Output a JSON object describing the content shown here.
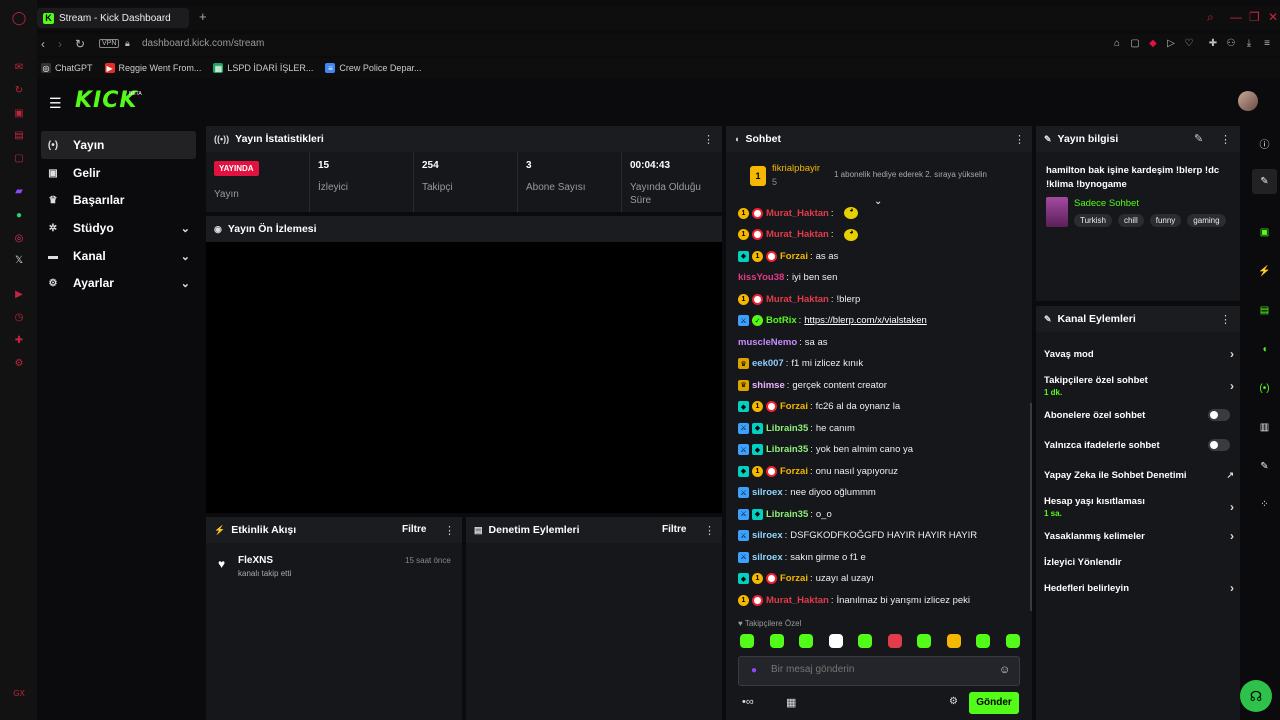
{
  "browser": {
    "tab_title": "Stream - Kick Dashboard",
    "url_host": "dashboard.kick.com",
    "url_path": "/stream",
    "vpn": "VPN",
    "bookmarks": [
      "ChatGPT",
      "Reggie Went From...",
      "LSPD İDARİ İŞLER...",
      "Crew Police Depar..."
    ]
  },
  "app": {
    "logo": "KICK",
    "beta": "BETA"
  },
  "nav": [
    {
      "label": "Yayın",
      "icon": "broadcast-icon",
      "glyph": "((•))",
      "active": true
    },
    {
      "label": "Gelir",
      "icon": "wallet-icon",
      "glyph": "▣"
    },
    {
      "label": "Başarılar",
      "icon": "trophy-icon",
      "glyph": "🏆"
    },
    {
      "label": "Stüdyo",
      "icon": "studio-icon",
      "glyph": "✱",
      "expandable": true
    },
    {
      "label": "Kanal",
      "icon": "channel-icon",
      "glyph": "▬",
      "expandable": true
    },
    {
      "label": "Ayarlar",
      "icon": "settings-icon",
      "glyph": "⚙",
      "expandable": true
    }
  ],
  "stats": {
    "title": "Yayın İstatistikleri",
    "status_badge": "YAYINDA",
    "status_label": "Yayın",
    "items": [
      {
        "value": "15",
        "label": "İzleyici"
      },
      {
        "value": "254",
        "label": "Takipçi"
      },
      {
        "value": "3",
        "label": "Abone Sayısı"
      },
      {
        "value": "00:04:43",
        "label": "Yayında Olduğu Süre"
      }
    ]
  },
  "preview": {
    "title": "Yayın Ön İzlemesi"
  },
  "activity": {
    "title": "Etkinlik Akışı",
    "filter": "Filtre",
    "events": [
      {
        "user": "FleXNS",
        "action": "kanalı takip etti",
        "time": "15 saat önce"
      }
    ]
  },
  "moderation": {
    "title": "Denetim Eylemleri",
    "filter": "Filtre"
  },
  "chat": {
    "title": "Sohbet",
    "pinned": {
      "user": "fikrialpbayir",
      "count": "5",
      "text": "1 abonelik hediye ederek 2. sıraya yükselin"
    },
    "messages": [
      {
        "badges": [
          "sub",
          "pb"
        ],
        "user": "Murat_Haktan",
        "color": "#e23b4a",
        "text": "",
        "emote": true
      },
      {
        "badges": [
          "sub",
          "pb"
        ],
        "user": "Murat_Haktan",
        "color": "#e23b4a",
        "text": "",
        "emote": true
      },
      {
        "badges": [
          "og",
          "sub",
          "pb"
        ],
        "user": "Forzai",
        "color": "#f5b700",
        "text": "as as"
      },
      {
        "badges": [],
        "user": "kissYou38",
        "color": "#e23b8a",
        "text": "iyi ben sen"
      },
      {
        "badges": [
          "sub",
          "pb"
        ],
        "user": "Murat_Haktan",
        "color": "#e23b4a",
        "text": "!blerp"
      },
      {
        "badges": [
          "mod",
          "bot"
        ],
        "user": "BotRix",
        "color": "#53fc18",
        "text": "https://blerp.com/x/vialstaken",
        "link": true
      },
      {
        "badges": [],
        "user": "muscleNemo",
        "color": "#c48dff",
        "text": "sa as"
      },
      {
        "badges": [
          "vip"
        ],
        "user": "eek007",
        "color": "#8ecbff",
        "text": "f1 mi izlicez kınık"
      },
      {
        "badges": [
          "vip"
        ],
        "user": "shimse",
        "color": "#e8b4ff",
        "text": "gerçek content creator"
      },
      {
        "badges": [
          "og",
          "sub",
          "pb"
        ],
        "user": "Forzai",
        "color": "#f5b700",
        "text": "fc26 al da oynanz la"
      },
      {
        "badges": [
          "mod",
          "og"
        ],
        "user": "Librain35",
        "color": "#8cf07a",
        "text": "he canım"
      },
      {
        "badges": [
          "mod",
          "og"
        ],
        "user": "Librain35",
        "color": "#8cf07a",
        "text": "yok ben almim cano ya"
      },
      {
        "badges": [
          "og",
          "sub",
          "pb"
        ],
        "user": "Forzai",
        "color": "#f5b700",
        "text": "onu nasıl yapıyoruz"
      },
      {
        "badges": [
          "mod"
        ],
        "user": "silroex",
        "color": "#8fd6ff",
        "text": "nee diyoo oğlummm"
      },
      {
        "badges": [
          "mod",
          "og"
        ],
        "user": "Librain35",
        "color": "#8cf07a",
        "text": "o_o"
      },
      {
        "badges": [
          "mod"
        ],
        "user": "silroex",
        "color": "#8fd6ff",
        "text": "DSFGKODFKOĞGFD HAYIR HAYIR HAYIR"
      },
      {
        "badges": [
          "mod"
        ],
        "user": "silroex",
        "color": "#8fd6ff",
        "text": "sakın girme o f1 e"
      },
      {
        "badges": [
          "og",
          "sub",
          "pb"
        ],
        "user": "Forzai",
        "color": "#f5b700",
        "text": "uzayı al uzayı"
      },
      {
        "badges": [
          "sub",
          "pb"
        ],
        "user": "Murat_Haktan",
        "color": "#e23b4a",
        "text": "İnanılmaz bi yarışmı izlicez peki"
      }
    ],
    "followers_only": "Takipçilere Özel",
    "input_placeholder": "Bir mesaj gönderin",
    "send": "Gönder"
  },
  "stream_info": {
    "title": "Yayın bilgisi",
    "stream_title": "hamilton bak işine kardeşim !blerp !dc !klima !bynogame",
    "category": "Sadece Sohbet",
    "tags": [
      "Turkish",
      "chill",
      "funny",
      "gaming"
    ]
  },
  "channel_actions": {
    "title": "Kanal Eylemleri",
    "rows": [
      {
        "label": "Yavaş mod",
        "type": "arrow"
      },
      {
        "label": "Takipçilere özel sohbet",
        "sub": "1 dk.",
        "type": "arrow"
      },
      {
        "label": "Abonelere özel sohbet",
        "type": "toggle"
      },
      {
        "label": "Yalnızca ifadelerle sohbet",
        "type": "toggle"
      },
      {
        "label": "Yapay Zeka ile Sohbet Denetimi",
        "type": "external"
      },
      {
        "label": "Hesap yaşı kısıtlaması",
        "sub": "1 sa.",
        "type": "arrow"
      },
      {
        "label": "Yasaklanmış kelimeler",
        "type": "arrow"
      },
      {
        "label": "İzleyici Yönlendir",
        "type": "none"
      },
      {
        "label": "Hedefleri belirleyin",
        "type": "arrow"
      }
    ]
  },
  "colors": {
    "brand": "#53fc18",
    "live": "#e1123f",
    "panel": "#16171a",
    "bg": "#0b0b0d"
  }
}
